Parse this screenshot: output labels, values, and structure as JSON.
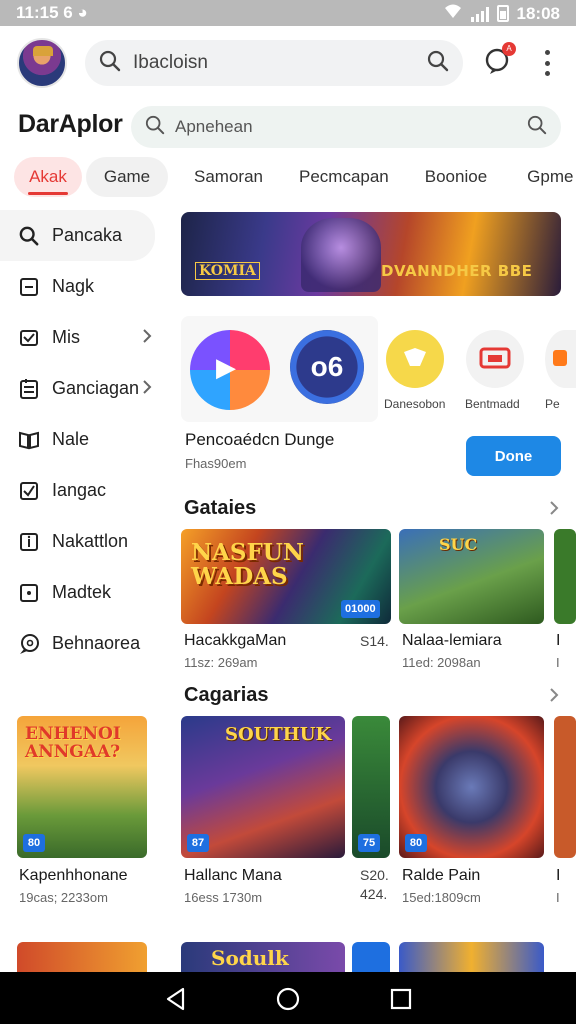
{
  "status": {
    "time": "11:15",
    "extra": "6",
    "right_time": "18:08"
  },
  "search_top": {
    "placeholder": "Ibacloisn"
  },
  "brand": "DarAplor",
  "search_main": {
    "placeholder": "Apnehean"
  },
  "tabs": [
    {
      "label": "Akak"
    },
    {
      "label": "Game"
    },
    {
      "label": "Samoran"
    },
    {
      "label": "Pecmcapan"
    },
    {
      "label": "Boonioe"
    },
    {
      "label": "Gpme"
    }
  ],
  "sidebar": {
    "items": [
      {
        "label": "Pancaka",
        "icon": "search-icon"
      },
      {
        "label": "Nagk",
        "icon": "square-icon"
      },
      {
        "label": "Mis",
        "icon": "mail-icon",
        "chevron": true
      },
      {
        "label": "Ganciagan",
        "icon": "document-icon",
        "chevron": true
      },
      {
        "label": "Nale",
        "icon": "book-icon"
      },
      {
        "label": "Iangac",
        "icon": "check-box-icon"
      },
      {
        "label": "Nakattlon",
        "icon": "info-icon"
      },
      {
        "label": "Madtek",
        "icon": "dot-square-icon"
      },
      {
        "label": "Behnaorea",
        "icon": "chat-icon"
      }
    ]
  },
  "banner": {
    "left_text": "KOMIA",
    "right_text": "DVANNDHER BBE"
  },
  "apps": [
    {
      "name": ""
    },
    {
      "name": ""
    },
    {
      "name": "Danesobon"
    },
    {
      "name": "Bentmadd"
    },
    {
      "name": "Pe"
    }
  ],
  "featured": {
    "title": "Pencoaédcn Dunge",
    "subtitle": "Fhas90em",
    "button": "Done"
  },
  "section1": {
    "title": "Gataies",
    "cards": [
      {
        "art_text": "NASFUN WADAS",
        "tag": "01000",
        "title": "HacakkgaMan",
        "price": "S14.",
        "sub": "11sz: 269am"
      },
      {
        "art_text": "SUC",
        "tag": "",
        "title": "Nalaa-lemiara",
        "price": "",
        "sub": "11ed: 2098an"
      },
      {
        "art_text": "",
        "tag": "",
        "title": "I",
        "price": "",
        "sub": "I"
      }
    ]
  },
  "section2": {
    "title": "Cagarias",
    "left_card": {
      "art_text": "ENHENOI ANNGAA?",
      "tag": "80",
      "title": "Kapenhhonane",
      "sub": "19cas; 2233om"
    },
    "cards": [
      {
        "art_text": "SOUTHUK",
        "tag": "87",
        "title": "Hallanc Mana",
        "price": "S20.",
        "price2": "424.",
        "sub": "16ess 1730m"
      },
      {
        "art_text": "",
        "tag": "75",
        "title": "",
        "price": "",
        "sub": ""
      },
      {
        "art_text": "",
        "tag": "80",
        "title": "Ralde Pain",
        "price": "",
        "sub": "15ed:1809cm"
      },
      {
        "art_text": "",
        "tag": "",
        "title": "I",
        "price": "",
        "sub": "I"
      }
    ]
  },
  "bottom_row": {
    "art_text": "Sodulk"
  },
  "colors": {
    "accent": "#e53935",
    "primary": "#1e88e5",
    "tab_bg": "#fde4e4"
  }
}
